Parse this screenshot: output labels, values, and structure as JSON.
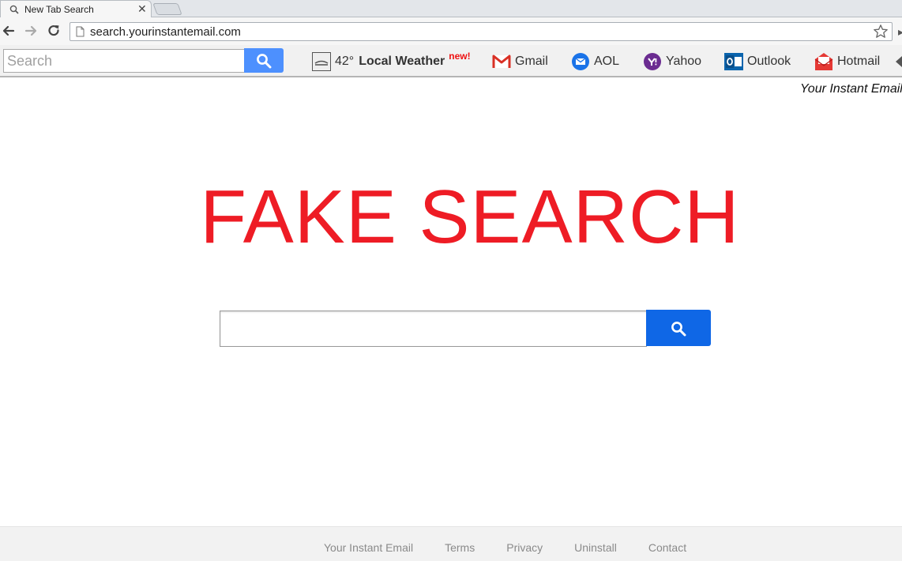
{
  "browser": {
    "tab_title": "New Tab Search",
    "close_glyph": "✕",
    "url": "search.yourinstantemail.com",
    "menu_glyph": "▸"
  },
  "toolbar": {
    "search_placeholder": "Search",
    "weather": {
      "temperature": "42°",
      "label": "Local Weather",
      "badge": "new!"
    },
    "links": [
      {
        "label": "Gmail",
        "icon": "gmail-icon"
      },
      {
        "label": "AOL",
        "icon": "aol-icon"
      },
      {
        "label": "Yahoo",
        "icon": "yahoo-icon"
      },
      {
        "label": "Outlook",
        "icon": "outlook-icon"
      },
      {
        "label": "Hotmail",
        "icon": "hotmail-icon"
      }
    ]
  },
  "page": {
    "brand": "Your Instant Email",
    "hero_title": "FAKE SEARCH",
    "search_placeholder": ""
  },
  "footer": {
    "links": [
      "Your Instant Email",
      "Terms",
      "Privacy",
      "Uninstall",
      "Contact"
    ]
  },
  "colors": {
    "hero": "#ee1c25",
    "search_button": "#0f67e6",
    "toolbar_search_button": "#4d90fe"
  }
}
